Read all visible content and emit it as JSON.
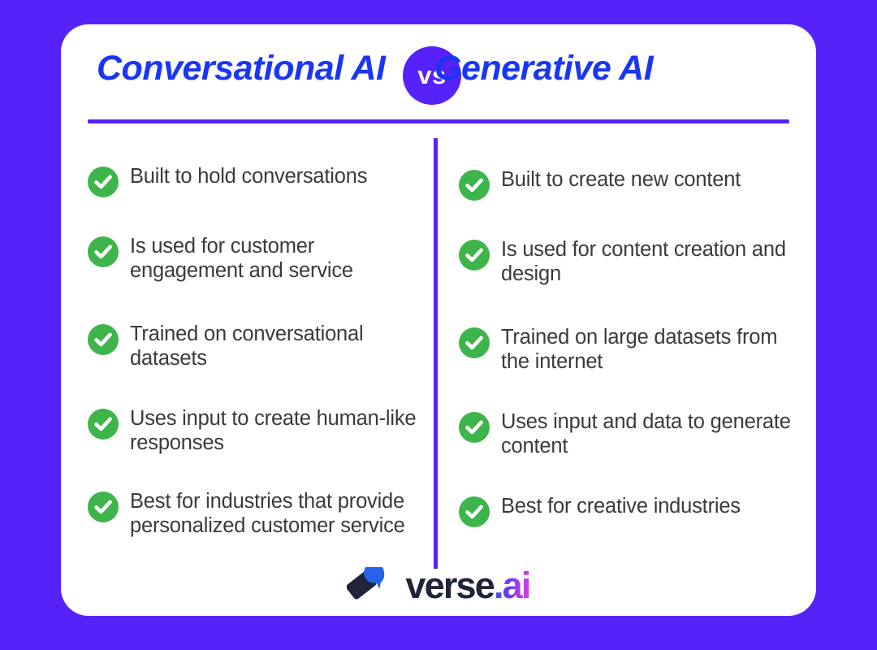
{
  "theme": {
    "background_color": "#5722FA",
    "card_color": "#FFFFFF",
    "title_color": "#1A36F5",
    "accent_color": "#5722FA",
    "check_color": "#3DB54A",
    "body_text_color": "#3A3A3C"
  },
  "header": {
    "left_title": "Conversational AI",
    "vs_label": "vs",
    "right_title": "Generative AI"
  },
  "columns": {
    "left": {
      "items": [
        {
          "icon": "check-circle-icon",
          "text": "Built to hold conversations"
        },
        {
          "icon": "check-circle-icon",
          "text": "Is used for customer engagement and service"
        },
        {
          "icon": "check-circle-icon",
          "text": "Trained on conversational datasets"
        },
        {
          "icon": "check-circle-icon",
          "text": "Uses input to create human-like responses"
        },
        {
          "icon": "check-circle-icon",
          "text": "Best for industries that provide personalized customer service"
        }
      ]
    },
    "right": {
      "items": [
        {
          "icon": "check-circle-icon",
          "text": "Built to create new content"
        },
        {
          "icon": "check-circle-icon",
          "text": "Is used for content creation and design"
        },
        {
          "icon": "check-circle-icon",
          "text": "Trained on large datasets from the internet"
        },
        {
          "icon": "check-circle-icon",
          "text": "Uses input and data to generate content"
        },
        {
          "icon": "check-circle-icon",
          "text": "Best for creative industries"
        }
      ]
    }
  },
  "logo": {
    "mark_icon": "verse-diamond-bubble-icon",
    "word": "verse",
    "suffix": ".ai"
  }
}
